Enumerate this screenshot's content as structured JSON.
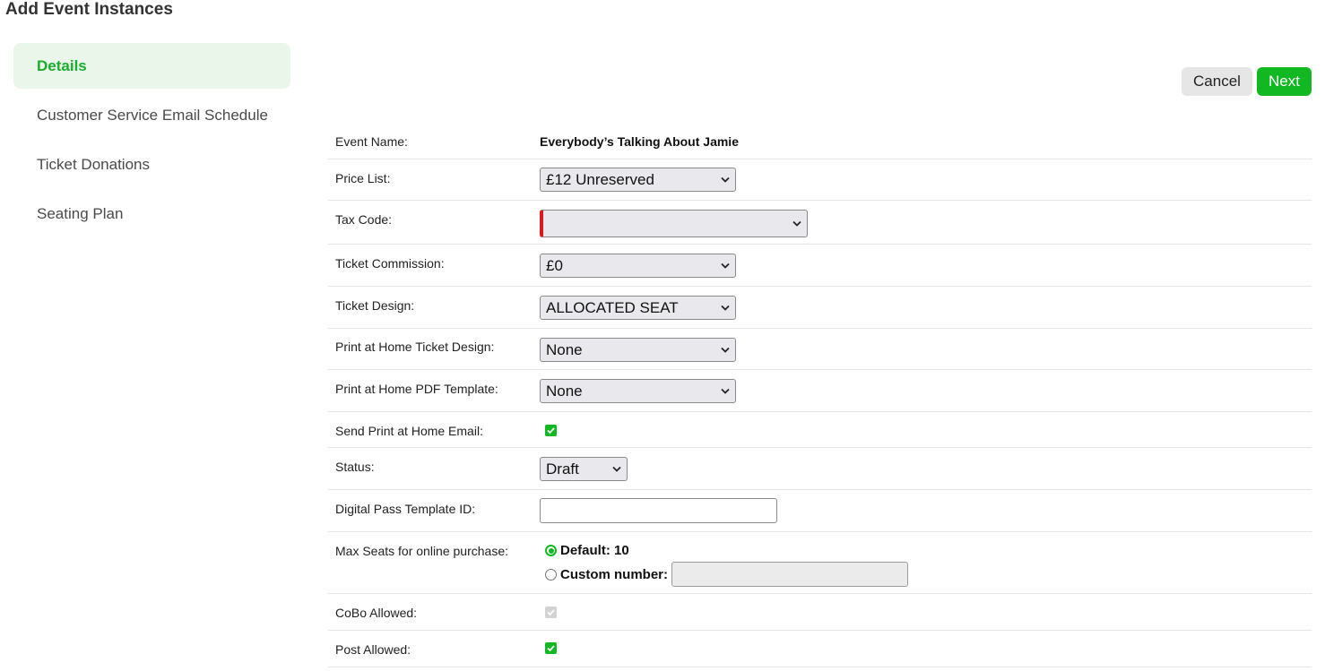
{
  "page": {
    "title": "Add Event Instances"
  },
  "sidebar": {
    "items": [
      {
        "label": "Details",
        "active": true
      },
      {
        "label": "Customer Service Email Schedule",
        "active": false
      },
      {
        "label": "Ticket Donations",
        "active": false
      },
      {
        "label": "Seating Plan",
        "active": false
      }
    ]
  },
  "actions": {
    "cancel_label": "Cancel",
    "next_label": "Next"
  },
  "form": {
    "event_name": {
      "label": "Event Name:",
      "value": "Everybody’s Talking About Jamie"
    },
    "price_list": {
      "label": "Price List:",
      "value": "£12 Unreserved"
    },
    "tax_code": {
      "label": "Tax Code:",
      "value": ""
    },
    "ticket_commission": {
      "label": "Ticket Commission:",
      "value": "£0"
    },
    "ticket_design": {
      "label": "Ticket Design:",
      "value": "ALLOCATED SEAT"
    },
    "pah_ticket_design": {
      "label": "Print at Home Ticket Design:",
      "value": "None"
    },
    "pah_pdf_template": {
      "label": "Print at Home PDF Template:",
      "value": "None"
    },
    "send_pah_email": {
      "label": "Send Print at Home Email:",
      "checked": true
    },
    "status": {
      "label": "Status:",
      "value": "Draft"
    },
    "digital_pass_template_id": {
      "label": "Digital Pass Template ID:",
      "value": ""
    },
    "max_seats": {
      "label": "Max Seats for online purchase:",
      "default_label": "Default: 10",
      "custom_label": "Custom number:",
      "custom_value": "",
      "selected": "default"
    },
    "cobo_allowed": {
      "label": "CoBo Allowed:",
      "checked": true,
      "disabled": true
    },
    "post_allowed": {
      "label": "Post Allowed:",
      "checked": true
    }
  },
  "colors": {
    "accent": "#11b821",
    "active_bg": "#eaf6ea",
    "required": "#e0161c"
  }
}
